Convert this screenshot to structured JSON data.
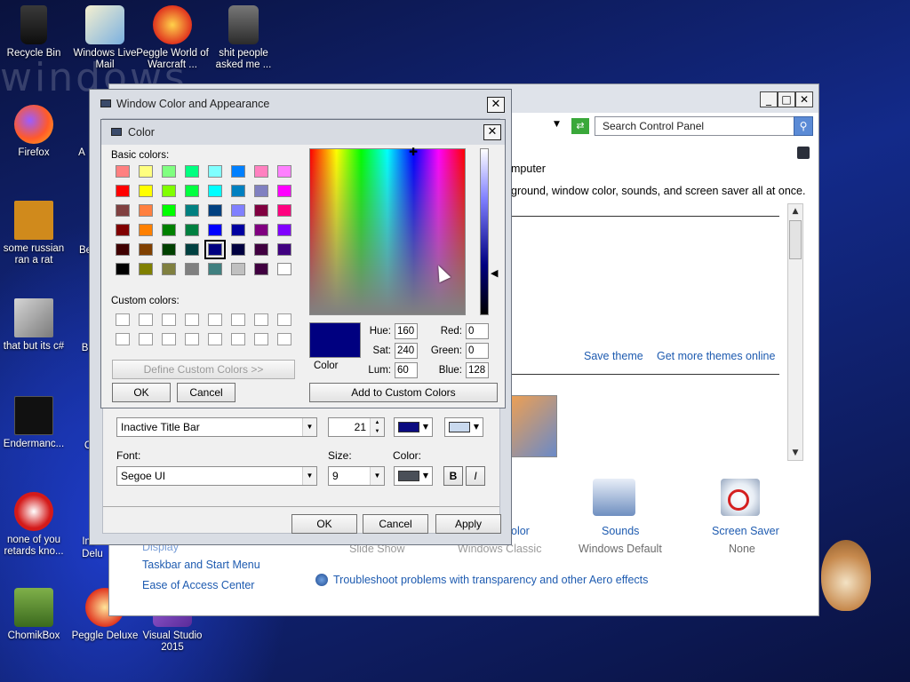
{
  "desktop": {
    "wordmark": "windows",
    "icons": [
      {
        "label": "Recycle Bin"
      },
      {
        "label": "Windows Live Mail"
      },
      {
        "label": "Peggle World of Warcraft ..."
      },
      {
        "label": "shit people asked me ..."
      },
      {
        "label": "Firefox"
      },
      {
        "label": "some russian ran a rat"
      },
      {
        "label": "that but its c#"
      },
      {
        "label": "Endermanc..."
      },
      {
        "label": "none of you retards kno..."
      },
      {
        "label": "ChomikBox"
      },
      {
        "label": "Peggle Deluxe"
      },
      {
        "label": "Visual Studio 2015"
      }
    ],
    "partial_labels": [
      "A",
      "Be",
      "Big",
      "C",
      "Ins",
      "Delu"
    ]
  },
  "control_panel": {
    "search_placeholder": "Search Control Panel",
    "heading_fragment": "mputer",
    "description_fragment": "ground, window color, sounds, and screen saver all at once.",
    "save_theme": "Save theme",
    "get_more_themes": "Get more themes online",
    "bottom_items": [
      {
        "label": "olor",
        "sub": ""
      },
      {
        "label": "",
        "sub": "Slide Show"
      },
      {
        "label": "",
        "sub": "Windows Classic"
      },
      {
        "label": "Sounds",
        "sub": "Windows Default"
      },
      {
        "label": "Screen Saver",
        "sub": "None"
      }
    ],
    "left_links": [
      "Display",
      "Taskbar and Start Menu",
      "Ease of Access Center"
    ],
    "troubleshoot": "Troubleshoot problems with transparency and other Aero effects"
  },
  "window_color_dialog": {
    "title": "Window Color and Appearance",
    "item_value": "Inactive Title Bar",
    "size_value": "21",
    "font_label": "Font:",
    "font_value": "Segoe UI",
    "size_label": "Size:",
    "font_size_value": "9",
    "color_label": "Color:",
    "bold": "B",
    "italic": "I",
    "ok": "OK",
    "cancel": "Cancel",
    "apply": "Apply",
    "color1": "#0b0b80",
    "color2": "#c9d9ee",
    "font_color": "#4a4f58"
  },
  "color_dialog": {
    "title": "Color",
    "basic_colors_label": "Basic colors:",
    "custom_colors_label": "Custom colors:",
    "define_custom": "Define Custom Colors >>",
    "ok": "OK",
    "cancel": "Cancel",
    "add_to_custom": "Add to Custom Colors",
    "color_solid_label": "Color",
    "hue_label": "Hue:",
    "sat_label": "Sat:",
    "lum_label": "Lum:",
    "red_label": "Red:",
    "green_label": "Green:",
    "blue_label": "Blue:",
    "hue": "160",
    "sat": "240",
    "lum": "60",
    "red": "0",
    "green": "0",
    "blue": "128",
    "current_color": "#000080",
    "basic_colors": [
      "#ff8080",
      "#ffff80",
      "#80ff80",
      "#00ff80",
      "#80ffff",
      "#0080ff",
      "#ff80c0",
      "#ff80ff",
      "#ff0000",
      "#ffff00",
      "#80ff00",
      "#00ff40",
      "#00ffff",
      "#0080c0",
      "#8080c0",
      "#ff00ff",
      "#804040",
      "#ff8040",
      "#00ff00",
      "#008080",
      "#004080",
      "#8080ff",
      "#800040",
      "#ff0080",
      "#800000",
      "#ff8000",
      "#008000",
      "#008040",
      "#0000ff",
      "#0000a0",
      "#800080",
      "#8000ff",
      "#400000",
      "#804000",
      "#004000",
      "#004040",
      "#000080",
      "#000040",
      "#400040",
      "#400080",
      "#000000",
      "#808000",
      "#808040",
      "#808080",
      "#408080",
      "#c0c0c0",
      "#400040",
      "#ffffff"
    ]
  }
}
